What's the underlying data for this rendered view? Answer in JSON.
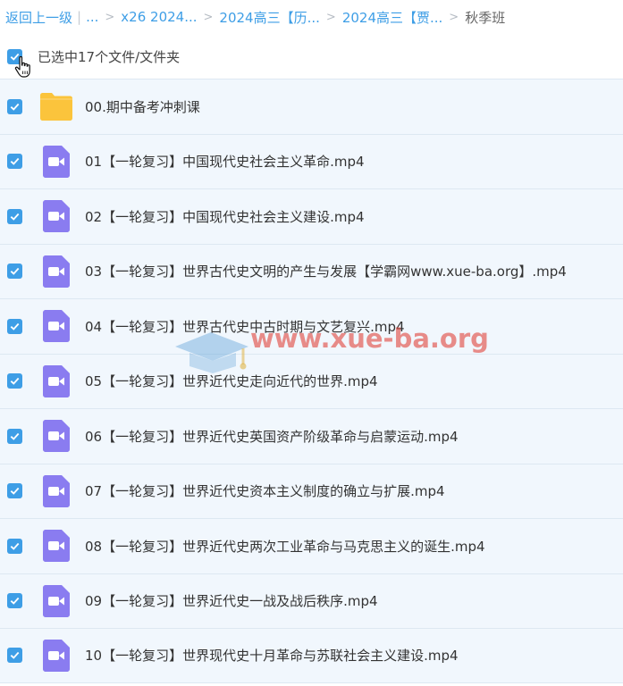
{
  "breadcrumb": {
    "back_label": "返回上一级",
    "ellipsis": "...",
    "items": [
      "x26 2024...",
      "2024高三【历...",
      "2024高三【贾..."
    ],
    "current": "秋季班"
  },
  "selection": {
    "label": "已选中17个文件/文件夹"
  },
  "files": [
    {
      "name": "00.期中备考冲刺课",
      "type": "folder-icon"
    },
    {
      "name": "01【一轮复习】中国现代史社会主义革命.mp4",
      "type": "video-icon"
    },
    {
      "name": "02【一轮复习】中国现代史社会主义建设.mp4",
      "type": "video-icon"
    },
    {
      "name": "03【一轮复习】世界古代史文明的产生与发展【学霸网www.xue-ba.org】.mp4",
      "type": "video-icon"
    },
    {
      "name": "04【一轮复习】世界古代史中古时期与文艺复兴.mp4",
      "type": "video-icon"
    },
    {
      "name": "05【一轮复习】世界近代史走向近代的世界.mp4",
      "type": "video-icon"
    },
    {
      "name": "06【一轮复习】世界近代史英国资产阶级革命与启蒙运动.mp4",
      "type": "video-icon"
    },
    {
      "name": "07【一轮复习】世界近代史资本主义制度的确立与扩展.mp4",
      "type": "video-icon"
    },
    {
      "name": "08【一轮复习】世界近代史两次工业革命与马克思主义的诞生.mp4",
      "type": "video-icon"
    },
    {
      "name": "09【一轮复习】世界近代史一战及战后秩序.mp4",
      "type": "video-icon"
    },
    {
      "name": "10【一轮复习】世界现代史十月革命与苏联社会主义建设.mp4",
      "type": "video-icon"
    }
  ],
  "watermark": {
    "text": "www.xue-ba.org"
  },
  "colors": {
    "accent": "#3e9ee6",
    "row_bg": "#f1f7fd",
    "folder": "#fbc43c",
    "video": "#8a7cf0",
    "watermark": "#e04840"
  }
}
